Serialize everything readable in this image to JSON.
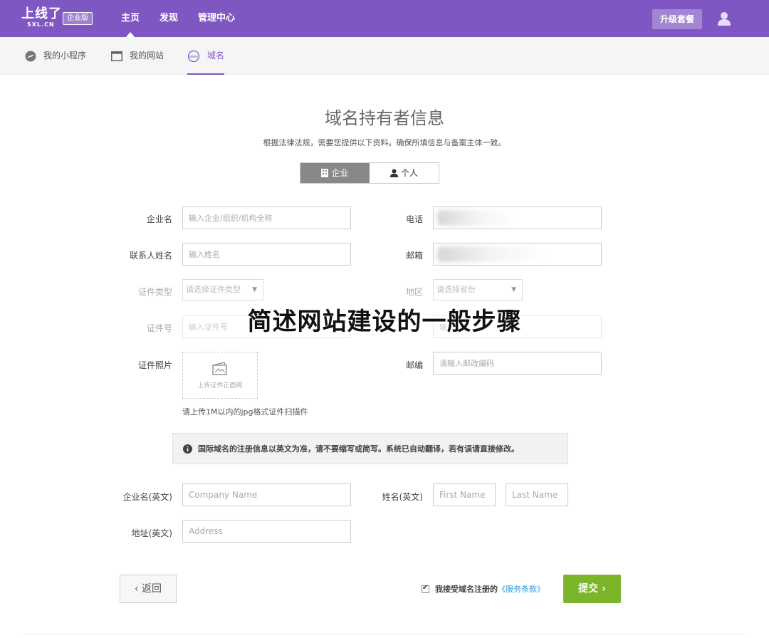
{
  "header": {
    "logo_main": "上线了",
    "logo_sub": "SXL.CN",
    "edition": "企业版",
    "nav": [
      "主页",
      "发现",
      "管理中心"
    ],
    "upgrade": "升级套餐"
  },
  "subnav": {
    "items": [
      "我的小程序",
      "我的网站",
      "域名"
    ]
  },
  "page": {
    "title": "域名持有者信息",
    "description": "根据法律法规，需要您提供以下资料。确保所填信息与备案主体一致。",
    "tabs": [
      "企业",
      "个人"
    ],
    "overlay": "简述网站建设的一般步骤"
  },
  "form": {
    "company_label": "企业名",
    "company_placeholder": "输入企业/组织/机构全称",
    "phone_label": "电话",
    "contact_label": "联系人姓名",
    "contact_placeholder": "输入姓名",
    "email_label": "邮箱",
    "idtype_label": "证件类型",
    "idtype_select": "请选择证件类型",
    "region_label": "地区",
    "region_select": "请选择省份",
    "idnum_label": "证件号",
    "idnum_placeholder": "输入证件号",
    "address_placeholder": "输入",
    "photo_label": "证件照片",
    "photo_upload": "上传证件正面照",
    "zip_label": "邮编",
    "zip_placeholder": "请输入邮政编码",
    "photo_hint": "请上传1M以内的jpg格式证件扫描件",
    "notice": "国际域名的注册信息以英文为准，请不要缩写或简写。系统已自动翻译，若有误请直接修改。",
    "company_en_label": "企业名(英文)",
    "company_en_placeholder": "Company Name",
    "name_en_label": "姓名(英文)",
    "first_name_placeholder": "First Name",
    "last_name_placeholder": "Last Name",
    "address_en_label": "地址(英文)",
    "address_en_placeholder": "Address"
  },
  "footer": {
    "back": "‹ 返回",
    "agree_text": "我接受域名注册的",
    "terms_link": "《服务条款》",
    "submit": "提交 ›"
  },
  "colors": {
    "brand": "#7e57c2",
    "submit": "#7bb62a",
    "link": "#2c9fd9"
  }
}
